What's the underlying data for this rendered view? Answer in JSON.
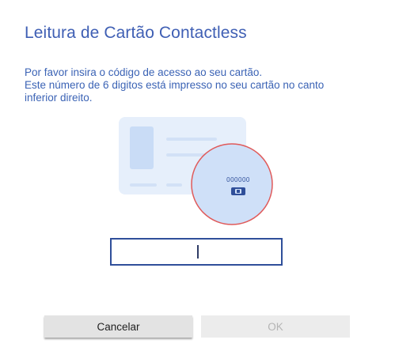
{
  "dialog": {
    "title": "Leitura de Cartão Contactless",
    "description_lines": [
      "Por favor insira o código de acesso ao seu cartão.",
      "Este número de 6 digitos está impresso no seu cartão no canto",
      "inferior direito."
    ]
  },
  "illustration": {
    "card_code": "000000",
    "card_color": "#e6effb",
    "highlight_circle_color": "#e05a5a"
  },
  "input": {
    "value": "",
    "placeholder": ""
  },
  "buttons": {
    "cancel_label": "Cancelar",
    "ok_label": "OK"
  },
  "colors": {
    "title": "#3f5fb4",
    "text": "#3b63b5",
    "input_border": "#2f4f9a"
  }
}
